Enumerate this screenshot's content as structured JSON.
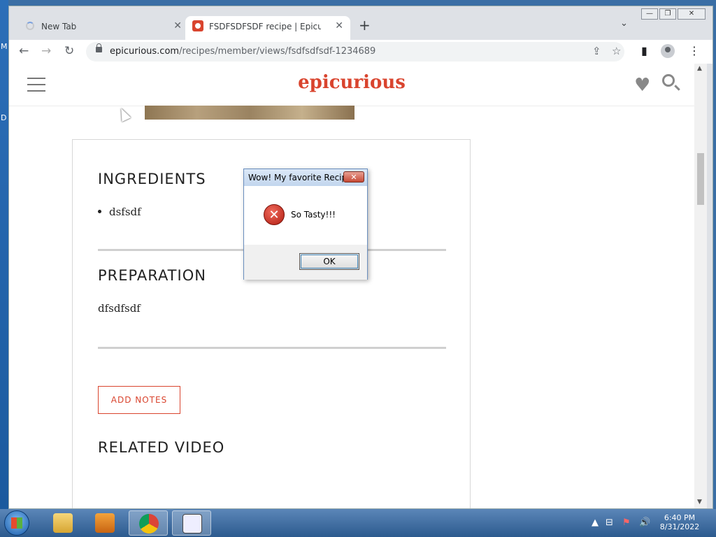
{
  "desktop": {
    "edge_letters": [
      "M",
      "D"
    ]
  },
  "browser": {
    "tabs": [
      {
        "title": "New Tab"
      },
      {
        "title": "FSDFSDFSDF recipe | Epicurious.com"
      }
    ],
    "new_tab": "+",
    "tab_search": "⌄",
    "window_controls": {
      "minimize": "—",
      "restore": "❐",
      "close": "✕"
    },
    "url_host": "epicurious.com",
    "url_path": "/recipes/member/views/fsdfsdfsdf-1234689"
  },
  "site": {
    "logo": "epicurious"
  },
  "recipe": {
    "ingredients_heading": "INGREDIENTS",
    "ingredients": [
      "dsfsdf"
    ],
    "preparation_heading": "PREPARATION",
    "preparation_text": "dfsdfsdf",
    "add_notes": "ADD NOTES",
    "related_heading": "RELATED VIDEO"
  },
  "dialog": {
    "title": "Wow! My favorite Recipe",
    "message": "So Tasty!!!",
    "ok": "OK",
    "close": "✕",
    "icon": "error-icon"
  },
  "taskbar": {
    "time": "6:40 PM",
    "date": "8/31/2022"
  },
  "colors": {
    "brand": "#d9442e",
    "taskbar": "#2c5a8e"
  }
}
